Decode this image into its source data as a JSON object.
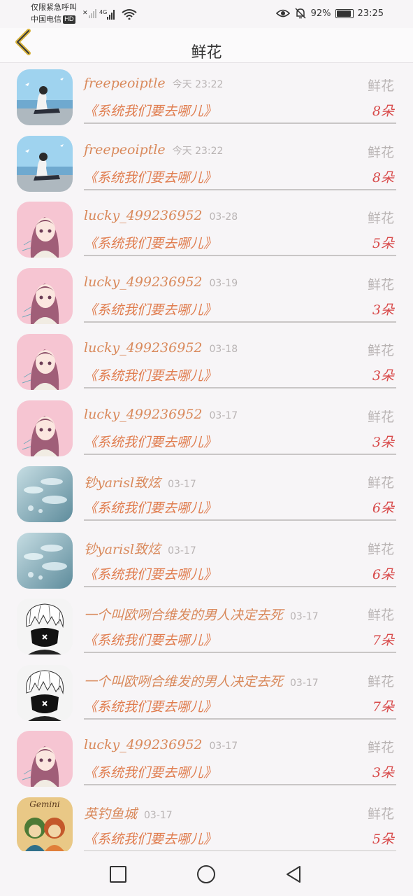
{
  "status_bar": {
    "line1": "仅限紧急呼叫",
    "line2": "中国电信",
    "hd_badge": "HD",
    "network": "4G",
    "battery_text": "92%",
    "battery_level": 0.92,
    "time": "23:25"
  },
  "header": {
    "title": "鲜花",
    "back_icon": "chevron-left-icon"
  },
  "records": [
    {
      "user": "freepeoiptle",
      "time": "今天 23:22",
      "type": "鲜花",
      "message": "《系统我们要去哪儿》",
      "count": "8朵",
      "avatar": "seaside-girl"
    },
    {
      "user": "freepeoiptle",
      "time": "今天 23:22",
      "type": "鲜花",
      "message": "《系统我们要去哪儿》",
      "count": "8朵",
      "avatar": "seaside-girl"
    },
    {
      "user": "lucky_499236952",
      "time": "03-28",
      "type": "鲜花",
      "message": "《系统我们要去哪儿》",
      "count": "5朵",
      "avatar": "anime-girl-pink"
    },
    {
      "user": "lucky_499236952",
      "time": "03-19",
      "type": "鲜花",
      "message": "《系统我们要去哪儿》",
      "count": "3朵",
      "avatar": "anime-girl-pink"
    },
    {
      "user": "lucky_499236952",
      "time": "03-18",
      "type": "鲜花",
      "message": "《系统我们要去哪儿》",
      "count": "3朵",
      "avatar": "anime-girl-pink"
    },
    {
      "user": "lucky_499236952",
      "time": "03-17",
      "type": "鲜花",
      "message": "《系统我们要去哪儿》",
      "count": "3朵",
      "avatar": "anime-girl-pink"
    },
    {
      "user": "钞yarisl致炫",
      "time": "03-17",
      "type": "鲜花",
      "message": "《系统我们要去哪儿》",
      "count": "6朵",
      "avatar": "water-drops"
    },
    {
      "user": "钞yarisl致炫",
      "time": "03-17",
      "type": "鲜花",
      "message": "《系统我们要去哪儿》",
      "count": "6朵",
      "avatar": "water-drops"
    },
    {
      "user": "一个叫欧咧合维发的男人决定去死",
      "time": "03-17",
      "type": "鲜花",
      "message": "《系统我们要去哪儿》",
      "count": "7朵",
      "avatar": "masked-boy"
    },
    {
      "user": "一个叫欧咧合维发的男人决定去死",
      "time": "03-17",
      "type": "鲜花",
      "message": "《系统我们要去哪儿》",
      "count": "7朵",
      "avatar": "masked-boy"
    },
    {
      "user": "lucky_499236952",
      "time": "03-17",
      "type": "鲜花",
      "message": "《系统我们要去哪儿》",
      "count": "3朵",
      "avatar": "anime-girl-pink"
    },
    {
      "user": "英钓鱼城",
      "time": "03-17",
      "type": "鲜花",
      "message": "《系统我们要去哪儿》",
      "count": "5朵",
      "avatar": "gemini-twins",
      "avatar_text": "Gemini"
    }
  ],
  "nav_bar": {
    "recent_icon": "square-icon",
    "home_icon": "circle-icon",
    "back_icon": "triangle-back-icon"
  },
  "colors": {
    "username": "#d9895b",
    "message": "#e07d4f",
    "count": "#d84a4a",
    "muted": "#b9b4b4"
  }
}
